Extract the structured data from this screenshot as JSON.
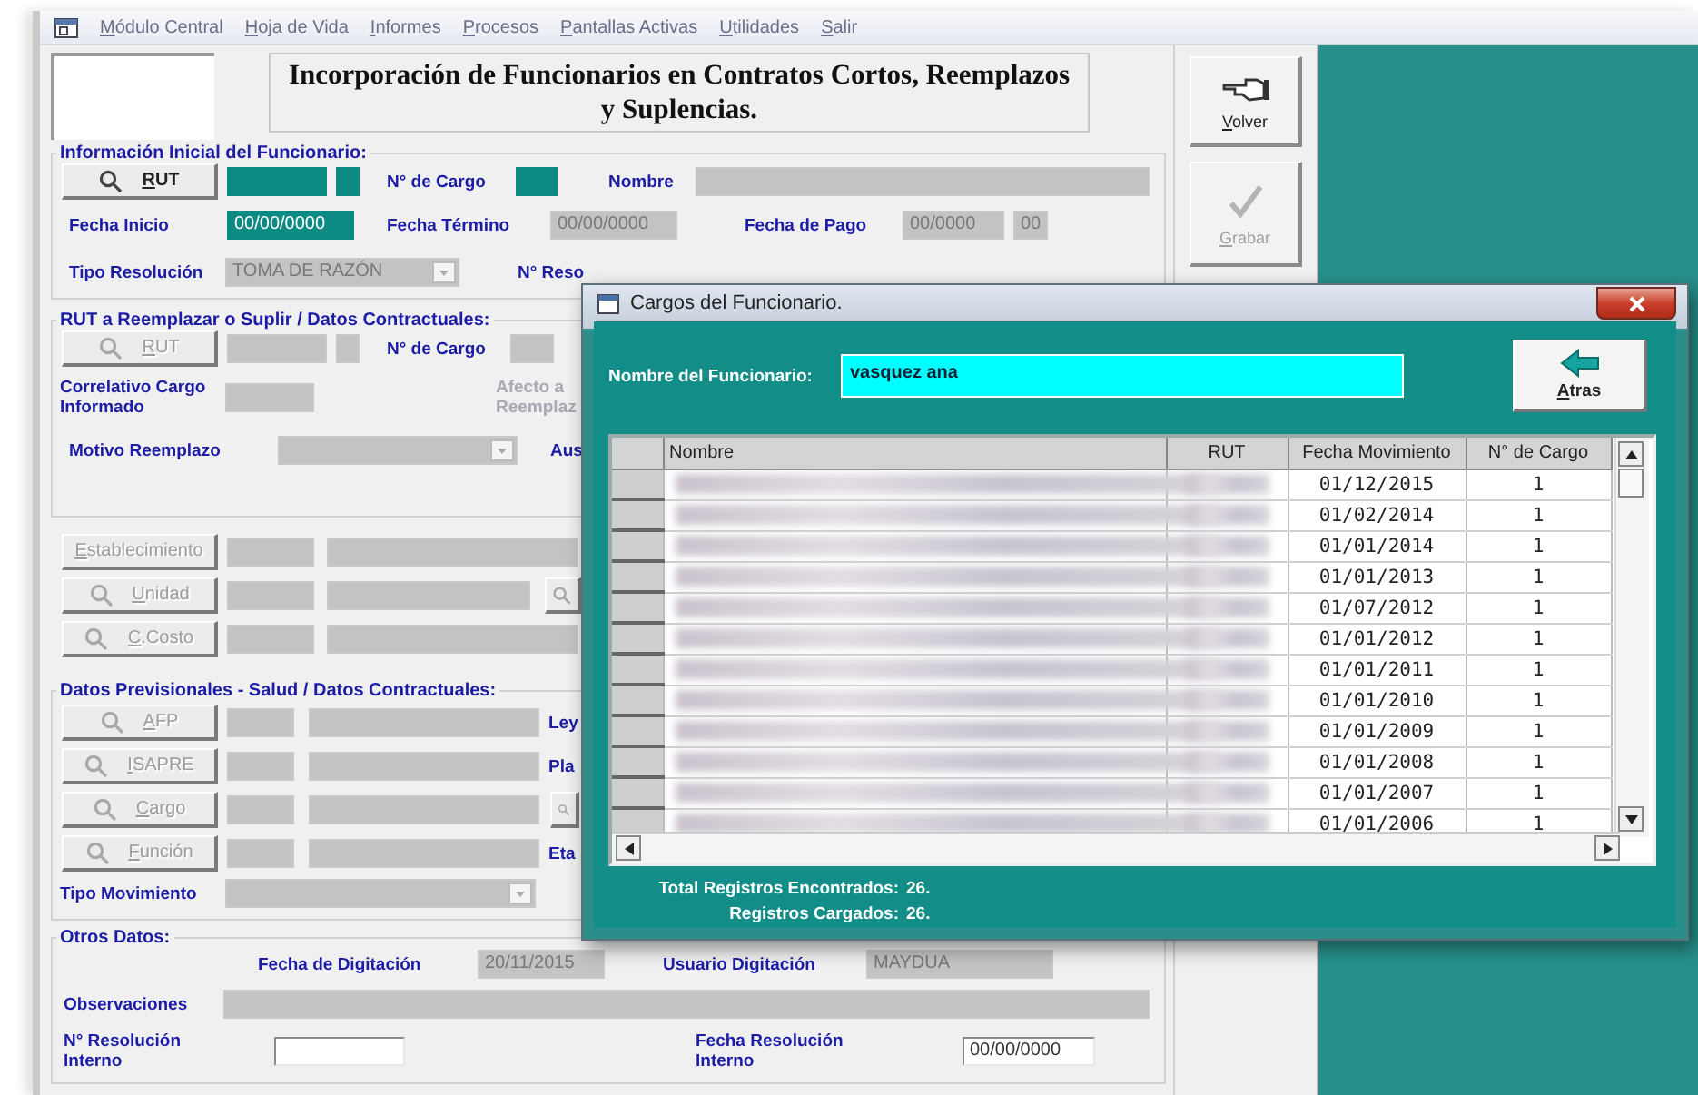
{
  "menu": [
    {
      "label": "Módulo Central"
    },
    {
      "label": "Hoja de Vida"
    },
    {
      "label": "Informes"
    },
    {
      "label": "Procesos"
    },
    {
      "label": "Pantallas Activas"
    },
    {
      "label": "Utilidades"
    },
    {
      "label": "Salir"
    }
  ],
  "title": "Incorporación de Funcionarios en Contratos Cortos, Reemplazos y Suplencias.",
  "actions": [
    {
      "label": "Volver",
      "kind": "back",
      "disabled": false
    },
    {
      "label": "Grabar",
      "kind": "save",
      "disabled": true
    }
  ],
  "sections": [
    {
      "heading": "Información Inicial del Funcionario:",
      "lines": [
        {
          "items": [
            {
              "kind": "lookup",
              "label": "RUT",
              "disabled": false
            },
            {
              "kind": "field",
              "highlighted": true,
              "disabled": false
            },
            {
              "kind": "field",
              "highlighted": true,
              "disabled": false
            },
            {
              "kind": "label",
              "text": "N° de Cargo",
              "disabled": false
            },
            {
              "kind": "field",
              "highlighted": true,
              "disabled": false
            },
            {
              "kind": "label",
              "text": "Nombre",
              "disabled": false
            },
            {
              "kind": "field",
              "highlighted": false,
              "disabled": true
            }
          ]
        },
        {
          "items": [
            {
              "kind": "label",
              "text": "Fecha Inicio",
              "disabled": false
            },
            {
              "kind": "field",
              "highlighted": true,
              "disabled": false,
              "value": "00/00/0000"
            },
            {
              "kind": "label",
              "text": "Fecha Término",
              "disabled": false
            },
            {
              "kind": "field",
              "highlighted": false,
              "disabled": true,
              "value": "00/00/0000"
            },
            {
              "kind": "label",
              "text": "Fecha de Pago",
              "disabled": false
            },
            {
              "kind": "field",
              "highlighted": false,
              "disabled": true,
              "value": "00/0000"
            },
            {
              "kind": "field",
              "highlighted": false,
              "disabled": true,
              "value": "00"
            }
          ]
        },
        {
          "items": [
            {
              "kind": "label",
              "text": "Tipo Resolución",
              "disabled": false
            },
            {
              "kind": "combo",
              "disabled": true,
              "value": "TOMA DE RAZÓN"
            },
            {
              "kind": "label",
              "text": "N° Reso",
              "disabled": false
            }
          ]
        }
      ]
    },
    {
      "heading": "RUT a Reemplazar o Suplir / Datos Contractuales:",
      "lines": [
        {
          "items": [
            {
              "kind": "lookup",
              "label": "RUT",
              "disabled": true
            },
            {
              "kind": "field",
              "highlighted": false,
              "disabled": true
            },
            {
              "kind": "field",
              "highlighted": false,
              "disabled": true
            },
            {
              "kind": "label",
              "text": "N° de Cargo",
              "disabled": false
            },
            {
              "kind": "field",
              "highlighted": false,
              "disabled": true
            }
          ]
        },
        {
          "items": [
            {
              "kind": "label",
              "text": "Correlativo Cargo Informado",
              "disabled": false
            },
            {
              "kind": "field",
              "highlighted": false,
              "disabled": true
            },
            {
              "kind": "label",
              "text": "Afecto a\nReemplaz",
              "disabled": true
            }
          ]
        },
        {
          "items": [
            {
              "kind": "label",
              "text": "Motivo Reemplazo",
              "disabled": false
            },
            {
              "kind": "combo",
              "disabled": true
            },
            {
              "kind": "label",
              "text": "Aus",
              "disabled": false
            }
          ]
        }
      ]
    },
    {
      "lines": [
        {
          "items": [
            {
              "kind": "button",
              "label": "Establecimiento",
              "disabled": true
            },
            {
              "kind": "field",
              "highlighted": false,
              "disabled": true
            },
            {
              "kind": "field",
              "highlighted": false,
              "disabled": true
            }
          ]
        },
        {
          "items": [
            {
              "kind": "lookup",
              "label": "Unidad",
              "disabled": true
            },
            {
              "kind": "field",
              "highlighted": false,
              "disabled": true
            },
            {
              "kind": "field",
              "highlighted": false,
              "disabled": true
            },
            {
              "kind": "lookup",
              "disabled": true
            }
          ]
        },
        {
          "items": [
            {
              "kind": "lookup",
              "label": "C.Costo",
              "disabled": true
            },
            {
              "kind": "field",
              "highlighted": false,
              "disabled": true
            },
            {
              "kind": "field",
              "highlighted": false,
              "disabled": true
            }
          ]
        }
      ]
    },
    {
      "heading": "Datos Previsionales - Salud / Datos Contractuales:",
      "lines": [
        {
          "items": [
            {
              "kind": "lookup",
              "label": "AFP",
              "disabled": true
            },
            {
              "kind": "field",
              "highlighted": false,
              "disabled": true
            },
            {
              "kind": "field",
              "highlighted": false,
              "disabled": true
            },
            {
              "kind": "label",
              "text": "Ley",
              "disabled": false
            }
          ]
        },
        {
          "items": [
            {
              "kind": "lookup",
              "label": "ISAPRE",
              "disabled": true
            },
            {
              "kind": "field",
              "highlighted": false,
              "disabled": true
            },
            {
              "kind": "field",
              "highlighted": false,
              "disabled": true
            },
            {
              "kind": "label",
              "text": "Pla",
              "disabled": false
            }
          ]
        },
        {
          "items": [
            {
              "kind": "lookup",
              "label": "Cargo",
              "disabled": true
            },
            {
              "kind": "field",
              "highlighted": false,
              "disabled": true
            },
            {
              "kind": "field",
              "highlighted": false,
              "disabled": true
            },
            {
              "kind": "lookup",
              "disabled": true
            }
          ]
        },
        {
          "items": [
            {
              "kind": "lookup",
              "label": "Función",
              "disabled": true
            },
            {
              "kind": "field",
              "highlighted": false,
              "disabled": true
            },
            {
              "kind": "field",
              "highlighted": false,
              "disabled": true
            },
            {
              "kind": "label",
              "text": "Eta",
              "disabled": false
            }
          ]
        },
        {
          "items": [
            {
              "kind": "label",
              "text": "Tipo Movimiento",
              "disabled": false
            },
            {
              "kind": "combo",
              "disabled": true
            }
          ]
        }
      ]
    },
    {
      "heading": "Otros Datos:",
      "lines": [
        {
          "items": [
            {
              "kind": "label",
              "text": "Fecha de Digitación",
              "disabled": false
            },
            {
              "kind": "field",
              "highlighted": false,
              "disabled": true,
              "value": "20/11/2015"
            },
            {
              "kind": "label",
              "text": "Usuario Digitación",
              "disabled": false
            },
            {
              "kind": "field",
              "highlighted": false,
              "disabled": true,
              "value": "MAYDUA"
            }
          ]
        },
        {
          "items": [
            {
              "kind": "label",
              "text": "Observaciones",
              "disabled": false
            },
            {
              "kind": "field",
              "highlighted": false,
              "disabled": true
            }
          ]
        },
        {
          "items": [
            {
              "kind": "label",
              "text": "N° Resolución Interno",
              "disabled": false
            },
            {
              "kind": "field",
              "highlighted": false,
              "disabled": false
            },
            {
              "kind": "label",
              "text": "Fecha Resolución Interno",
              "disabled": false
            },
            {
              "kind": "field",
              "highlighted": false,
              "disabled": false,
              "value": "00/00/0000"
            }
          ]
        }
      ]
    }
  ],
  "dialog": {
    "title": "Cargos del Funcionario.",
    "name_label": "Nombre del Funcionario:",
    "name_value": "vasquez ana",
    "back_button": "Atras",
    "columns": [
      "Nombre",
      "RUT",
      "Fecha Movimiento",
      "N° de Cargo"
    ],
    "rows": [
      {
        "fecha_movimiento": "01/12/2015",
        "n_cargo": "1"
      },
      {
        "fecha_movimiento": "01/02/2014",
        "n_cargo": "1"
      },
      {
        "fecha_movimiento": "01/01/2014",
        "n_cargo": "1"
      },
      {
        "fecha_movimiento": "01/01/2013",
        "n_cargo": "1"
      },
      {
        "fecha_movimiento": "01/07/2012",
        "n_cargo": "1"
      },
      {
        "fecha_movimiento": "01/01/2012",
        "n_cargo": "1"
      },
      {
        "fecha_movimiento": "01/01/2011",
        "n_cargo": "1"
      },
      {
        "fecha_movimiento": "01/01/2010",
        "n_cargo": "1"
      },
      {
        "fecha_movimiento": "01/01/2009",
        "n_cargo": "1"
      },
      {
        "fecha_movimiento": "01/01/2008",
        "n_cargo": "1"
      },
      {
        "fecha_movimiento": "01/01/2007",
        "n_cargo": "1"
      },
      {
        "fecha_movimiento": "01/01/2006",
        "n_cargo": "1"
      }
    ],
    "totals": [
      {
        "label": "Total Registros Encontrados:",
        "value": "26."
      },
      {
        "label": "Registros Cargados:",
        "value": "26."
      }
    ]
  }
}
